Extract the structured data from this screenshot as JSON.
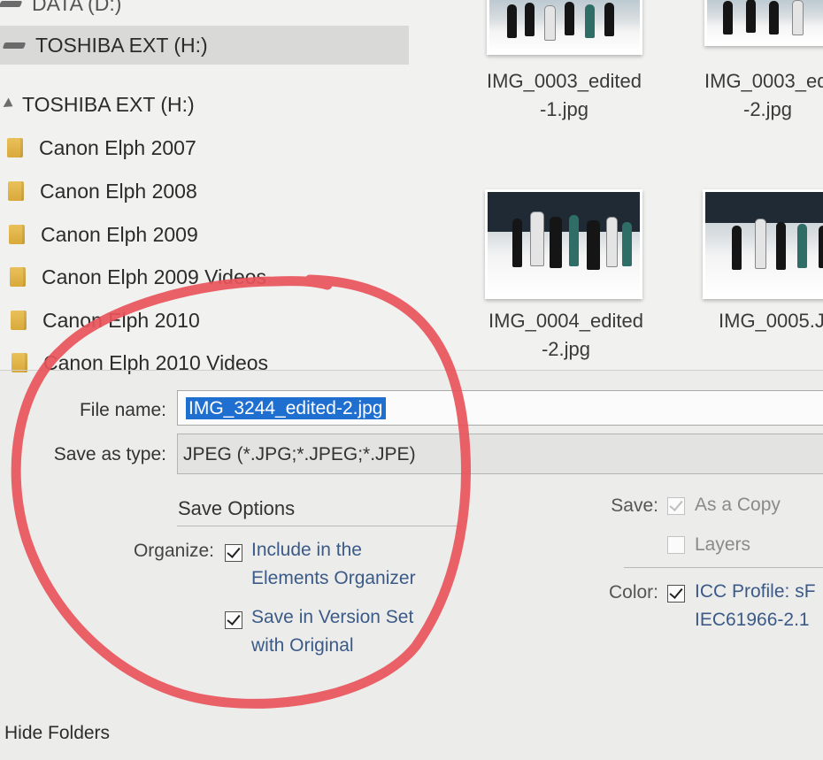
{
  "nav": {
    "partial_drive": "DATA (D:)",
    "selected_drive": "TOSHIBA EXT (H:)",
    "tree_drive": "TOSHIBA EXT (H:)",
    "folders": [
      "Canon Elph 2007",
      "Canon Elph 2008",
      "Canon Elph 2009",
      "Canon Elph 2009 Videos",
      "Canon Elph 2010",
      "Canon Elph 2010 Videos"
    ]
  },
  "files": [
    {
      "line1": "IMG_0003_edited",
      "line2": "-1.jpg"
    },
    {
      "line1": "IMG_0003_ed",
      "line2": "-2.jpg"
    },
    {
      "line1": "IMG_0004_edited",
      "line2": "-2.jpg"
    },
    {
      "line1": "IMG_0005.J",
      "line2": ""
    }
  ],
  "form": {
    "file_name_label": "File name:",
    "file_name_value": "IMG_3244_edited-2.jpg",
    "save_type_label": "Save as type:",
    "save_type_value": "JPEG (*.JPG;*.JPEG;*.JPE)"
  },
  "save_options": {
    "heading": "Save Options",
    "organize_label": "Organize:",
    "include_line1": "Include in the",
    "include_line2": "Elements Organizer",
    "include_checked": true,
    "version_line1": "Save in Version Set",
    "version_line2": "with Original",
    "version_checked": true
  },
  "save_right": {
    "save_label": "Save:",
    "as_copy": "As a Copy",
    "as_copy_checked": true,
    "layers": "Layers",
    "layers_checked": false,
    "color_label": "Color:",
    "icc_line1": "ICC Profile:  sF",
    "icc_line2": "IEC61966-2.1",
    "icc_checked": true
  },
  "footer": {
    "hide_folders": "Hide Folders"
  },
  "colors": {
    "selection": "#1f6fd1",
    "annotation_circle": "#e8545a",
    "option_text": "#3b5a88"
  }
}
